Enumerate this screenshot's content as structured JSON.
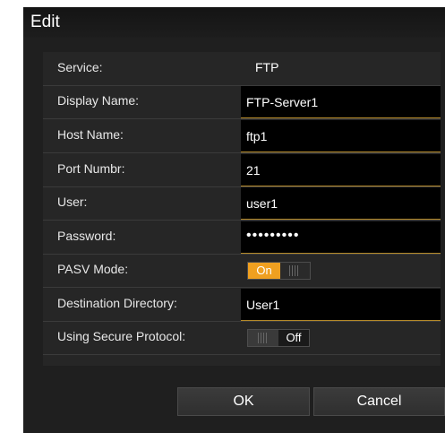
{
  "dialog": {
    "title": "Edit",
    "fields": {
      "service": {
        "label": "Service:",
        "value": "FTP"
      },
      "display_name": {
        "label": "Display Name:",
        "value": "FTP-Server1"
      },
      "host_name": {
        "label": "Host Name:",
        "value": "ftp1"
      },
      "port_number": {
        "label": "Port Numbr:",
        "value": "21"
      },
      "user": {
        "label": "User:",
        "value": "user1"
      },
      "password": {
        "label": "Password:",
        "value": "•••••••••"
      },
      "pasv_mode": {
        "label": "PASV Mode:",
        "state_label": "On",
        "enabled": true
      },
      "destination_directory": {
        "label": "Destination Directory:",
        "value": "User1"
      },
      "secure_protocol": {
        "label": "Using Secure Protocol:",
        "state_label": "Off",
        "enabled": false
      }
    },
    "buttons": {
      "ok": "OK",
      "cancel": "Cancel"
    },
    "colors": {
      "background": "#1f1f1f",
      "panel": "#262626",
      "input_underline": "#b58a2a",
      "toggle_on": "#f0a020"
    }
  }
}
